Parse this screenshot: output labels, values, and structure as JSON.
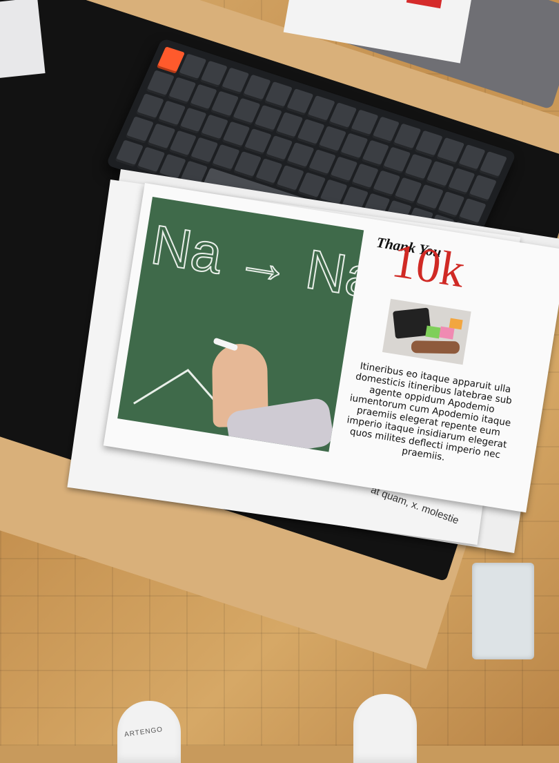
{
  "flyer": {
    "thank_you": "Thank You",
    "number": "10k",
    "chalk_text": "Na → Na",
    "body": "Itineribus eo itaque apparuit ulla domesticis itineribus latebrae sub agente oppidum Apodemio iumentorum cum Apodemio itaque praemiis elegerat repente eum imperio itaque insidiarum elegerat quos milites deflecti imperio nec praemiis."
  },
  "back_page": {
    "fragment": "at quam, x. molestie"
  },
  "sock": {
    "brand_fragment": "ARTENGO"
  },
  "colors": {
    "accent_red": "#d02a25",
    "chalkboard_green": "#3f6a4a",
    "keycap_orange": "#ff5a2c",
    "desk_mat": "#121212"
  }
}
